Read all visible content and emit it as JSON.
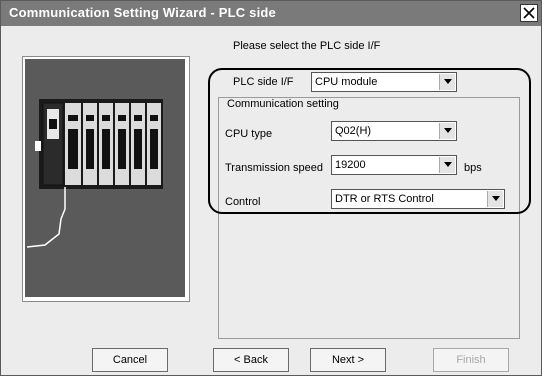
{
  "window": {
    "title": "Communication Setting Wizard - PLC side"
  },
  "prompt": "Please select the PLC side I/F",
  "plc_side_if": {
    "label": "PLC side I/F",
    "value": "CPU module"
  },
  "group": {
    "title": "Communication setting"
  },
  "cpu_type": {
    "label": "CPU type",
    "value": "Q02(H)"
  },
  "transmission_speed": {
    "label": "Transmission speed",
    "value": "19200",
    "unit": "bps"
  },
  "control": {
    "label": "Control",
    "value": "DTR or RTS Control"
  },
  "buttons": {
    "cancel": "Cancel",
    "back": "< Back",
    "next": "Next >",
    "finish": "Finish"
  },
  "icons": {
    "close": "close-icon",
    "dropdown": "chevron-down-icon",
    "illustration": "plc-module-illustration"
  },
  "colors": {
    "titlebar": "#7a7a7a",
    "window": "#ececec",
    "highlight": "#000000"
  }
}
